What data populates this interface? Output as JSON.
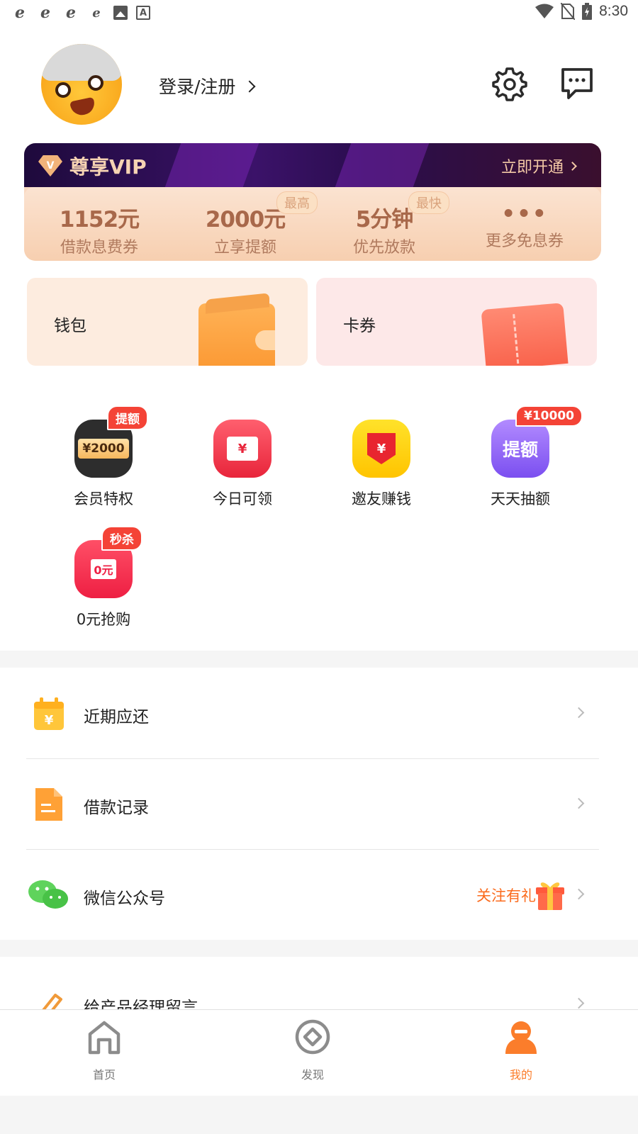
{
  "status_bar": {
    "time": "8:30",
    "left_icons": [
      "ie-browser-icon",
      "ie-browser-icon",
      "ie-browser-icon",
      "ie-browser-icon",
      "image-icon",
      "text-a-icon"
    ],
    "right_icons": [
      "wifi-icon",
      "no-sim-icon",
      "battery-charging-icon"
    ]
  },
  "header": {
    "login_label": "登录/注册",
    "settings_icon": "gear-icon",
    "message_icon": "chat-bubble-icon"
  },
  "vip": {
    "title": "尊享VIP",
    "badge_letter": "V",
    "cta": "立即开通",
    "perks": [
      {
        "value": "1152元",
        "label": "借款息费券",
        "tag": ""
      },
      {
        "value": "2000元",
        "label": "立享提额",
        "tag": "最高"
      },
      {
        "value": "5分钟",
        "label": "优先放款",
        "tag": "最快"
      },
      {
        "value": "•••",
        "label": "更多免息券",
        "tag": ""
      }
    ]
  },
  "cards": {
    "wallet": "钱包",
    "coupon": "卡券"
  },
  "features": [
    {
      "label": "会员特权",
      "badge": "提额",
      "icon_text": "¥2000",
      "icon": "member-ticket-icon"
    },
    {
      "label": "今日可领",
      "badge": "",
      "icon_text": "¥",
      "icon": "red-envelope-icon"
    },
    {
      "label": "邀友赚钱",
      "badge": "",
      "icon_text": "¥",
      "icon": "invite-shield-icon"
    },
    {
      "label": "天天抽额",
      "badge": "¥10000",
      "icon_text": "提额",
      "icon": "lottery-icon"
    },
    {
      "label": "0元抢购",
      "badge": "秒杀",
      "icon_text": "0元",
      "icon": "shopping-cart-icon"
    }
  ],
  "list": [
    {
      "label": "近期应还",
      "icon": "calendar-yen-icon",
      "extra": ""
    },
    {
      "label": "借款记录",
      "icon": "document-icon",
      "extra": ""
    },
    {
      "label": "微信公众号",
      "icon": "wechat-icon",
      "extra": "关注有礼"
    },
    {
      "label": "给产品经理留言",
      "icon": "pencil-icon",
      "extra": ""
    }
  ],
  "bottom_nav": [
    {
      "label": "首页",
      "icon": "home-icon",
      "active": false
    },
    {
      "label": "发现",
      "icon": "compass-icon",
      "active": false
    },
    {
      "label": "我的",
      "icon": "user-icon",
      "active": true
    }
  ],
  "colors": {
    "accent": "#fb7d2b",
    "vip_dark": "#2a0d4d",
    "vip_gold": "#a8684a",
    "badge_red": "#f44336"
  }
}
